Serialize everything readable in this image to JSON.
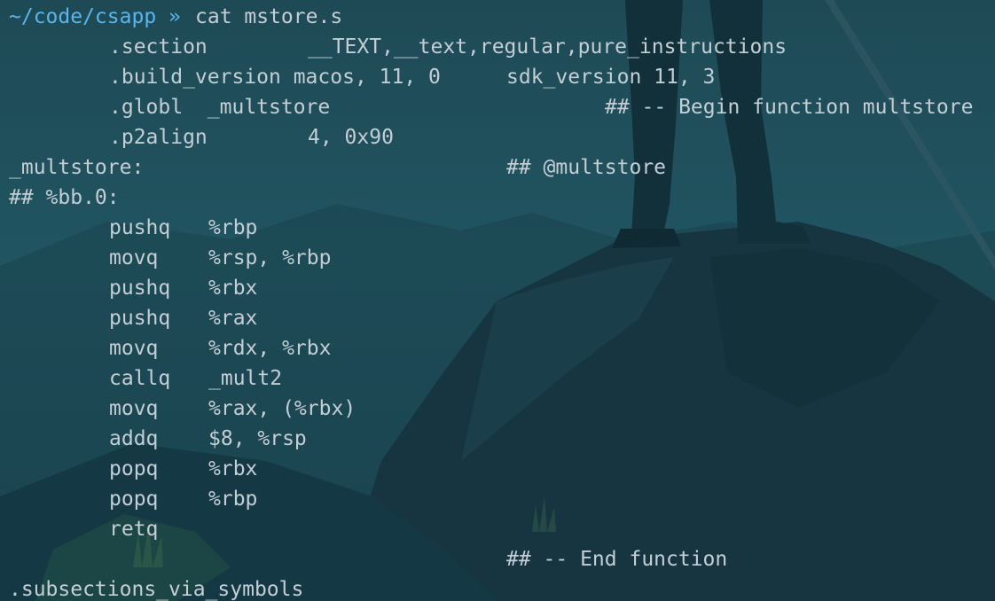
{
  "theme": {
    "background": "#173e4a",
    "text": "#c3ced5",
    "prompt": "#59b5ec"
  },
  "prompt": {
    "path": "~/code/csapp",
    "arrow": "»",
    "command": "cat mstore.s"
  },
  "lines": [
    {
      "name": "section-directive",
      "cols": [
        "",
        ".section",
        "__TEXT,__text,regular,pure_instructions"
      ]
    },
    {
      "name": "build-version-directive",
      "cols": [
        "",
        ".build_version macos, 11, 0",
        "sdk_version 11, 3"
      ]
    },
    {
      "name": "globl-directive",
      "cols": [
        "",
        ".globl  _multstore",
        "## -- Begin function multstore"
      ]
    },
    {
      "name": "p2align-directive",
      "cols": [
        "",
        ".p2align",
        "4, 0x90"
      ]
    },
    {
      "name": "multstore-label",
      "cols": [
        "_multstore:",
        "## @multstore"
      ]
    },
    {
      "name": "block-label",
      "cols": [
        "## %bb.0:"
      ]
    },
    {
      "name": "instr-pushq-rbp",
      "cols": [
        "pushq",
        "%rbp"
      ]
    },
    {
      "name": "instr-movq-rsp",
      "cols": [
        "movq",
        "%rsp, %rbp"
      ]
    },
    {
      "name": "instr-pushq-rbx",
      "cols": [
        "pushq",
        "%rbx"
      ]
    },
    {
      "name": "instr-pushq-rax",
      "cols": [
        "pushq",
        "%rax"
      ]
    },
    {
      "name": "instr-movq-rdx",
      "cols": [
        "movq",
        "%rdx, %rbx"
      ]
    },
    {
      "name": "instr-callq",
      "cols": [
        "callq",
        "_mult2"
      ]
    },
    {
      "name": "instr-movq-rax",
      "cols": [
        "movq",
        "%rax, (%rbx)"
      ]
    },
    {
      "name": "instr-addq",
      "cols": [
        "addq",
        "$8, %rsp"
      ]
    },
    {
      "name": "instr-popq-rbx",
      "cols": [
        "popq",
        "%rbx"
      ]
    },
    {
      "name": "instr-popq-rbp",
      "cols": [
        "popq",
        "%rbp"
      ]
    },
    {
      "name": "instr-retq",
      "cols": [
        "retq"
      ]
    },
    {
      "name": "end-function-comment",
      "cols": [
        "## -- End function"
      ]
    },
    {
      "name": "subsections-directive",
      "cols": [
        ".subsections_via_symbols"
      ]
    }
  ]
}
